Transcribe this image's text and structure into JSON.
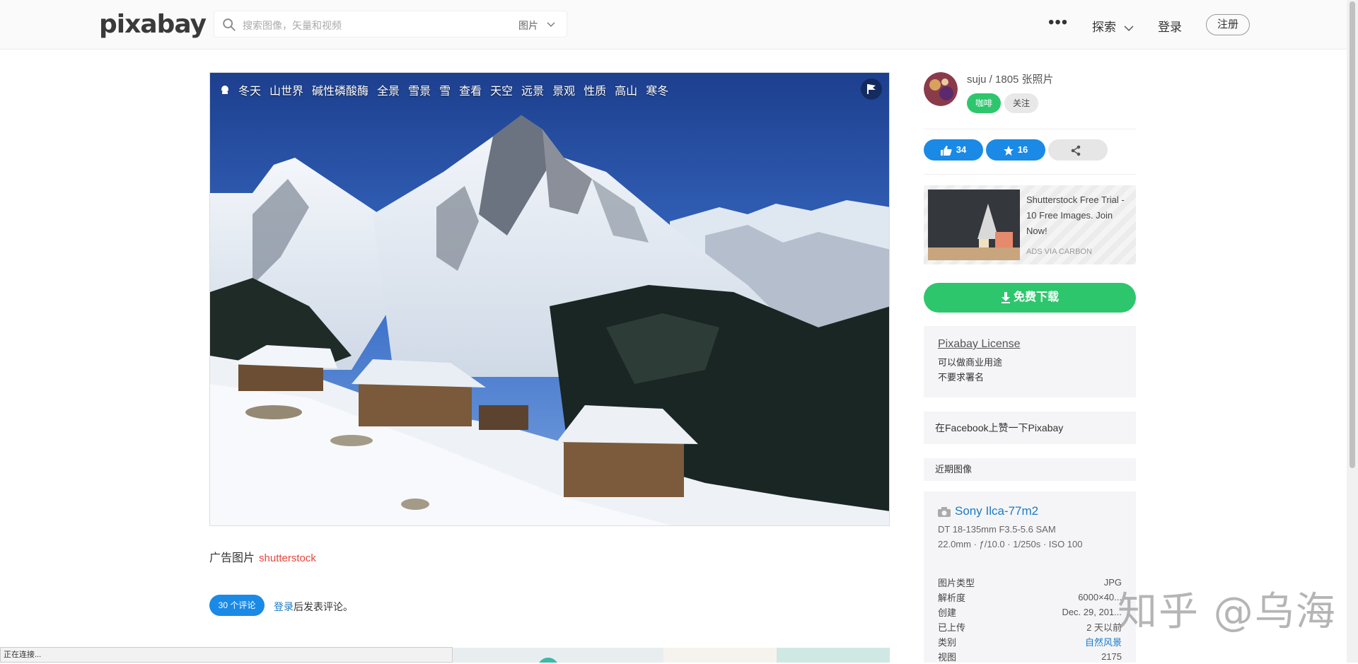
{
  "header": {
    "logo": "pixabay",
    "search_placeholder": "搜索图像，矢量和视频",
    "search_type": "图片",
    "more": "•••",
    "explore": "探索",
    "login": "登录",
    "signup": "注册"
  },
  "photo": {
    "tags": [
      "冬天",
      "山世界",
      "碱性磷酸酶",
      "全景",
      "雪景",
      "雪",
      "查看",
      "天空",
      "远景",
      "景观",
      "性质",
      "高山",
      "寒冬"
    ]
  },
  "ad": {
    "label": "广告图片",
    "brand": "shutterstock"
  },
  "comments": {
    "count_label": "30 个评论",
    "login_link": "登录",
    "suffix": "后发表评论。"
  },
  "author": {
    "name_line": "suju / 1805 张照片",
    "coffee": "咖啡",
    "follow": "关注"
  },
  "actions": {
    "likes": "34",
    "favorites": "16"
  },
  "carbon_ad": {
    "text": "Shutterstock Free Trial - 10 Free Images. Join Now!",
    "via": "ADS VIA CARBON"
  },
  "download": {
    "label": "免费下载"
  },
  "license": {
    "title": "Pixabay License",
    "line1": "可以做商业用途",
    "line2": "不要求署名"
  },
  "facebook": {
    "label": "在Facebook上赞一下Pixabay"
  },
  "recent": {
    "label": "近期图像"
  },
  "exif": {
    "camera": "Sony Ilca-77m2",
    "lens": "DT 18-135mm F3.5-5.6 SAM",
    "settings": "22.0mm · ƒ/10.0 · 1/250s · ISO 100",
    "rows": [
      {
        "k": "图片类型",
        "v": "JPG"
      },
      {
        "k": "解析度",
        "v": "6000×40..."
      },
      {
        "k": "创建",
        "v": "Dec. 29, 201..."
      },
      {
        "k": "已上传",
        "v": "2 天以前"
      },
      {
        "k": "类别",
        "v": "自然风景"
      },
      {
        "k": "视图",
        "v": "2175"
      }
    ]
  },
  "status": {
    "text": "正在连接..."
  },
  "watermark": "知乎 @乌海",
  "colors": {
    "green": "#2ec66d",
    "blue": "#1a8ae6",
    "link": "#1a7ac8"
  }
}
